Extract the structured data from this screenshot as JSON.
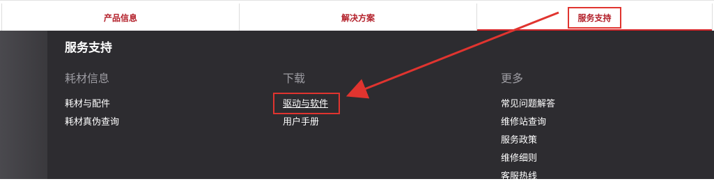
{
  "nav": {
    "tabs": [
      {
        "label": "产品信息"
      },
      {
        "label": "解决方案"
      },
      {
        "label": "服务支持"
      }
    ]
  },
  "panel": {
    "title": "服务支持",
    "columns": [
      {
        "heading": "耗材信息",
        "links": [
          "耗材与配件",
          "耗材真伪查询"
        ]
      },
      {
        "heading": "下载",
        "links": [
          "驱动与软件",
          "用户手册"
        ]
      },
      {
        "heading": "更多",
        "links": [
          "常见问题解答",
          "维修站查询",
          "服务政策",
          "维修细则",
          "客服热线"
        ]
      }
    ]
  },
  "colors": {
    "accent_red": "#d42529",
    "annotation_red": "#e0342f",
    "panel_bg": "#2b2a2e"
  }
}
